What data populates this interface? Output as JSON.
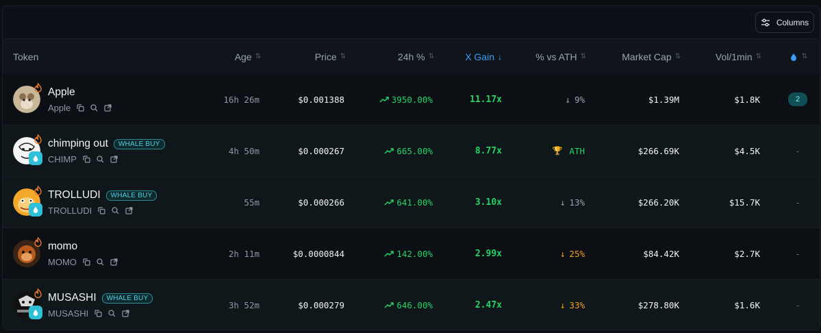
{
  "toolbar": {
    "columns_label": "Columns"
  },
  "headers": {
    "token": "Token",
    "age": "Age",
    "price": "Price",
    "change_24h": "24h %",
    "x_gain": "X Gain",
    "pct_vs_ath": "% vs ATH",
    "market_cap": "Market Cap",
    "vol_1min": "Vol/1min"
  },
  "sort_icons": {
    "idle": "⇅",
    "active": "↓"
  },
  "rows": [
    {
      "name": "Apple",
      "symbol": "Apple",
      "whale": "",
      "age": "16h 26m",
      "price": "$0.001388",
      "change": "3950.00%",
      "x_gain": "11.17x",
      "ath_arrow": "↓",
      "ath": "9%",
      "market_cap": "$1.39M",
      "vol": "$1.8K",
      "last": "2"
    },
    {
      "name": "chimping out",
      "symbol": "CHIMP",
      "whale": "WHALE BUY",
      "age": "4h 50m",
      "price": "$0.000267",
      "change": "665.00%",
      "x_gain": "8.77x",
      "ath_arrow": "🏆",
      "ath": "ATH",
      "market_cap": "$266.69K",
      "vol": "$4.5K",
      "last": "-"
    },
    {
      "name": "TROLLUDI",
      "symbol": "TROLLUDI",
      "whale": "WHALE BUY",
      "age": "55m",
      "price": "$0.000266",
      "change": "641.00%",
      "x_gain": "3.10x",
      "ath_arrow": "↓",
      "ath": "13%",
      "market_cap": "$266.20K",
      "vol": "$15.7K",
      "last": "-"
    },
    {
      "name": "momo",
      "symbol": "MOMO",
      "whale": "",
      "age": "2h 11m",
      "price": "$0.0000844",
      "change": "142.00%",
      "x_gain": "2.99x",
      "ath_arrow": "↓",
      "ath": "25%",
      "market_cap": "$84.42K",
      "vol": "$2.7K",
      "last": "-"
    },
    {
      "name": "MUSASHI",
      "symbol": "MUSASHI",
      "whale": "WHALE BUY",
      "age": "3h 52m",
      "price": "$0.000279",
      "change": "646.00%",
      "x_gain": "2.47x",
      "ath_arrow": "↓",
      "ath": "33%",
      "market_cap": "$278.80K",
      "vol": "$1.6K",
      "last": "-"
    }
  ],
  "colors": {
    "positive": "#25d366",
    "warning": "#f0a020",
    "accent": "#3b9ff5",
    "whale_badge": "#4fd1e3"
  }
}
